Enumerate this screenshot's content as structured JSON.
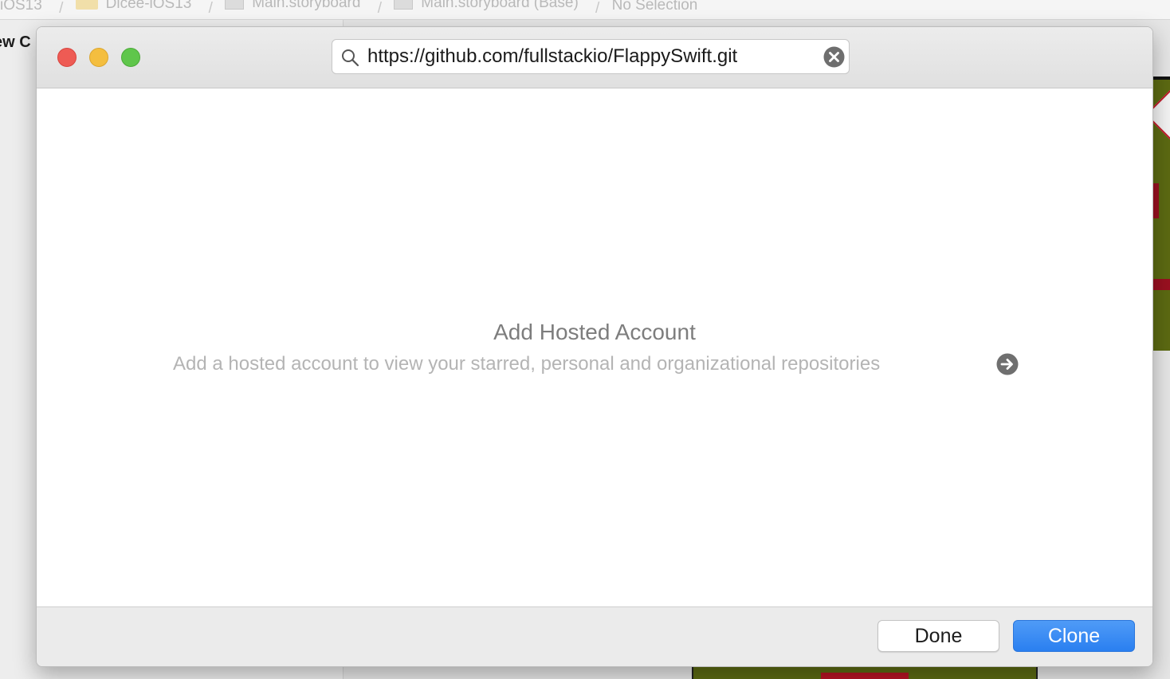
{
  "background": {
    "path_bar": {
      "crumbs": [
        "iOS13",
        "Dicee-iOS13",
        "Main.storyboard",
        "Main.storyboard (Base)",
        "No Selection"
      ]
    },
    "left_panel_title": "ew C"
  },
  "dialog": {
    "search": {
      "value": "https://github.com/fullstackio/FlappySwift.git"
    },
    "empty_state": {
      "title": "Add Hosted Account",
      "subtitle": "Add a hosted account to view your starred, personal and organizational repositories"
    },
    "buttons": {
      "done_label": "Done",
      "clone_label": "Clone"
    }
  },
  "colors": {
    "accent": "#2a7ff0",
    "close": "#ee5b54",
    "minimize": "#f4be3f",
    "maximize": "#5fc64b"
  },
  "icons": {
    "search": "magnifying-glass",
    "clear": "circle-x",
    "add_account": "circle-arrow-right"
  }
}
